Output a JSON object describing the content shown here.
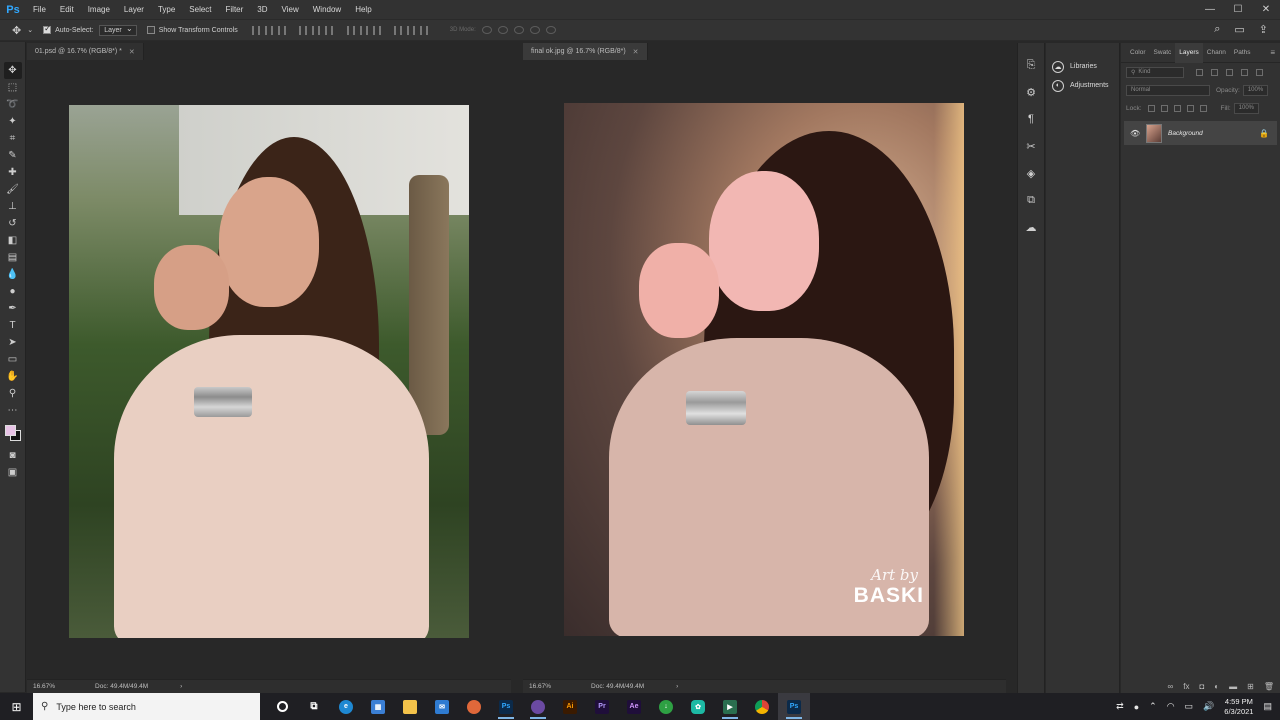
{
  "app": {
    "logo": "Ps"
  },
  "menu": [
    "File",
    "Edit",
    "Image",
    "Layer",
    "Type",
    "Select",
    "Filter",
    "3D",
    "View",
    "Window",
    "Help"
  ],
  "window_controls": {
    "minimize": "—",
    "maximize": "☐",
    "close": "✕"
  },
  "options": {
    "auto_select_label": "Auto-Select:",
    "auto_select_checked": true,
    "auto_select_target": "Layer",
    "transform_label": "Show Transform Controls",
    "mode3d_label": "3D Mode:"
  },
  "documents": [
    {
      "tab": "01.psd @ 16.7% (RGB/8*) *",
      "zoom": "16.67%",
      "doc_size": "Doc: 49.4M/49.4M"
    },
    {
      "tab": "final ok.jpg @ 16.7% (RGB/8*)",
      "zoom": "16.67%",
      "doc_size": "Doc: 49.4M/49.4M"
    }
  ],
  "watermark": {
    "line1": "Art by",
    "line2": "BASKI"
  },
  "side_panel": {
    "libraries": "Libraries",
    "adjustments": "Adjustments"
  },
  "panel_tabs": [
    "Color",
    "Swatc",
    "Layers",
    "Chann",
    "Paths"
  ],
  "active_panel_tab": "Layers",
  "layers": {
    "kind_placeholder": "Kind",
    "blend_mode": "Normal",
    "opacity_label": "Opacity:",
    "opacity_value": "100%",
    "lock_label": "Lock:",
    "fill_label": "Fill:",
    "fill_value": "100%",
    "items": [
      {
        "name": "Background",
        "visible": true,
        "locked": true
      }
    ]
  },
  "taskbar": {
    "search_placeholder": "Type here to search",
    "time": "4:59 PM",
    "date": "6/3/2021"
  },
  "colors": {
    "foreground": "#e8c3e6",
    "background": "#111111",
    "accent": "#31a8ff"
  }
}
